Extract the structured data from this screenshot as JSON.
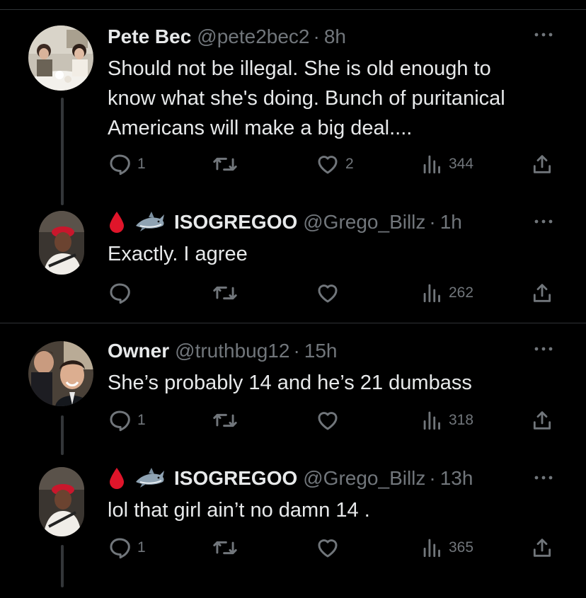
{
  "tweets": [
    {
      "name": "Pete Bec",
      "handle": "@pete2bec2",
      "time": "8h",
      "text_lines": [
        "Should not be illegal. She is old enough to",
        "know what she's doing. Bunch of puritanical",
        "Americans will make a big deal...."
      ],
      "replies": "1",
      "retweets": "",
      "likes": "2",
      "views": "344"
    },
    {
      "name": "ISOGREGOO",
      "handle": "@Grego_Billz",
      "time": "1h",
      "text_lines": [
        "Exactly. I agree"
      ],
      "replies": "",
      "retweets": "",
      "likes": "",
      "views": "262"
    },
    {
      "name": "Owner",
      "handle": "@truthbug12",
      "time": "15h",
      "text_lines": [
        "She’s probably 14 and he’s 21 dumbass"
      ],
      "replies": "1",
      "retweets": "",
      "likes": "",
      "views": "318"
    },
    {
      "name": "ISOGREGOO",
      "handle": "@Grego_Billz",
      "time": "13h",
      "text_lines": [
        "lol that girl ain’t no damn 14 ."
      ],
      "replies": "1",
      "retweets": "",
      "likes": "",
      "views": "365"
    }
  ],
  "separator": "·",
  "icons": {
    "name_emoji": [
      "blood-drop-icon",
      "shark-icon"
    ],
    "more": "more-options-icon",
    "reply": "reply-icon",
    "retweet": "retweet-icon",
    "like": "heart-icon",
    "views": "views-icon",
    "share": "share-icon"
  },
  "colors": {
    "background": "#000000",
    "text": "#e7e9ea",
    "secondary": "#71767b",
    "divider": "#2f3336",
    "thread_line": "#333639",
    "blood_drop": "#e0152a"
  }
}
